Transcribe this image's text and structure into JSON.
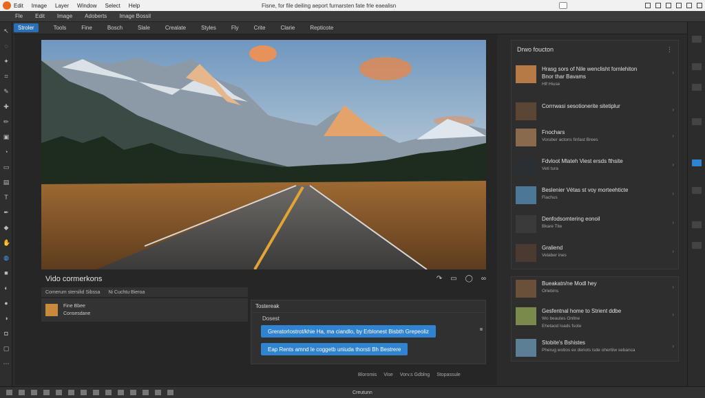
{
  "titlebar": {
    "menu": [
      "Edit",
      "Image",
      "Layer",
      "Window",
      "Select",
      "Help"
    ],
    "title": "Fisne, for file deiling aeport furnarsten fate frle eaealisn"
  },
  "toolbar": {
    "items": [
      "Fle",
      "Edit",
      "Image",
      "Adoberts",
      "Image Bossil"
    ]
  },
  "optionsbar": {
    "selected": "Stroler",
    "items": [
      "Tools",
      "Fine",
      "Bosch",
      "Slale",
      "Crealate",
      "Styles",
      "Fly",
      "Crite",
      "Clarie",
      "Repticote"
    ]
  },
  "video": {
    "title": "Vido cormerkons",
    "controls": [
      "↷",
      "▭",
      "◯",
      "∞"
    ]
  },
  "comments": {
    "bar": [
      "Comerum stersilid Sibssa",
      "Ni Cuchtu Bieroa"
    ],
    "card": {
      "name": "Fine Bbee",
      "meta": "Consesdane"
    }
  },
  "chat": {
    "title": "Tostereak",
    "subtitle": "Dosest",
    "button1": "Greratorlostrot/khie Ha, ma ciandlo, by Erblonest Bisbth Grepeoliz",
    "button2": "Eap Rents amnd le coggetb uniuda thorsti Bh Bestrere"
  },
  "bottom_meta": [
    "Bloromis",
    "Vise",
    "Vorv.s Gdblng",
    "Stopassule"
  ],
  "right_panel": {
    "title": "Drwo foucton",
    "items": [
      {
        "title": "Hrasg sors of Nile wenclisht fornlehiton",
        "title2": "Bnor thar Bavams",
        "sub": "Hlf Hiuse"
      },
      {
        "title": "Corrrwasi sesotionerite sitetiplur",
        "sub": ""
      },
      {
        "title": "Fnochars",
        "sub": "Voruber actons finfast Brees"
      },
      {
        "title": "Fdvloot Mlateh Viest ersds fthsite",
        "sub": "Veti tura"
      },
      {
        "title": "Beslenier Vétas st voy morteehticte",
        "sub": "Flachus"
      },
      {
        "title": "Denfodsomtering eonoil",
        "sub": "Bkare Tite"
      },
      {
        "title": "Graliend",
        "sub": "Velaber ines"
      }
    ]
  },
  "right_panel2": {
    "items": [
      {
        "title": "Bueakatn/ne Modl hey",
        "sub": "Orlebins"
      },
      {
        "title": "Gesfentnal home to Strient ddbe",
        "sub": "Wo beautes Onllne",
        "sub2": "Ehetaod loads fsote"
      },
      {
        "title": "Stobite's Bshistes",
        "sub": "Pherug wotios ex deriots isde ohertiiw sebanca"
      }
    ]
  },
  "statusbar": {
    "zoom": "Creutunn"
  }
}
